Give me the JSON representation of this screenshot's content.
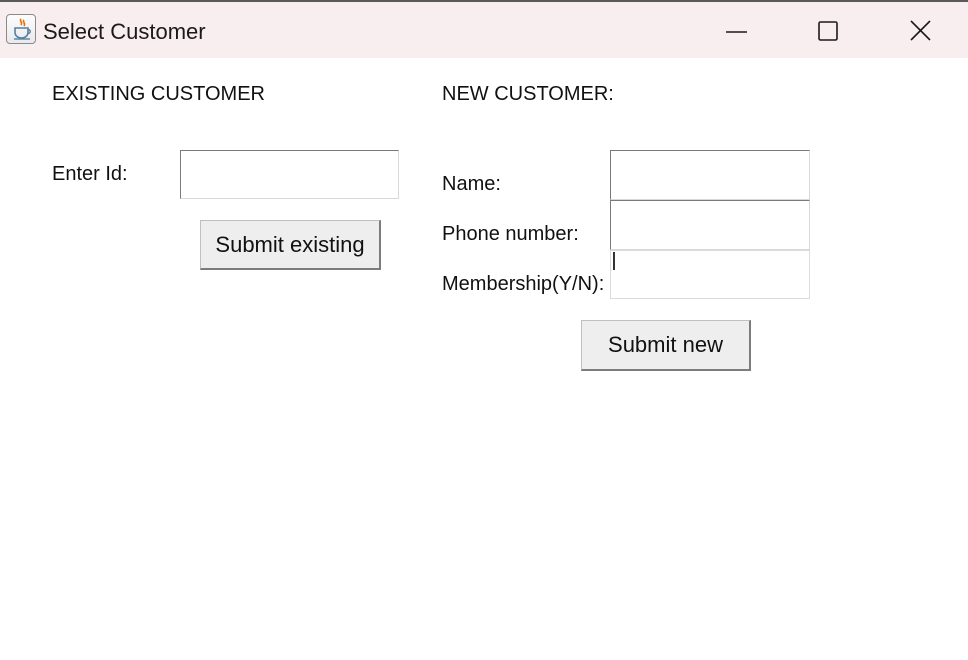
{
  "window": {
    "title": "Select Customer",
    "app_icon": "java-coffee-cup-icon",
    "controls": {
      "minimize_icon": "minimize-icon",
      "maximize_icon": "maximize-icon",
      "close_icon": "close-icon"
    }
  },
  "existing": {
    "heading": "EXISTING CUSTOMER",
    "id_label": "Enter Id:",
    "id_value": "",
    "submit_label": "Submit existing"
  },
  "new_customer": {
    "heading": "NEW CUSTOMER:",
    "name_label": "Name:",
    "name_value": "",
    "phone_label": "Phone number:",
    "phone_value": "",
    "membership_label": "Membership(Y/N):",
    "membership_value": "",
    "submit_label": "Submit new"
  }
}
